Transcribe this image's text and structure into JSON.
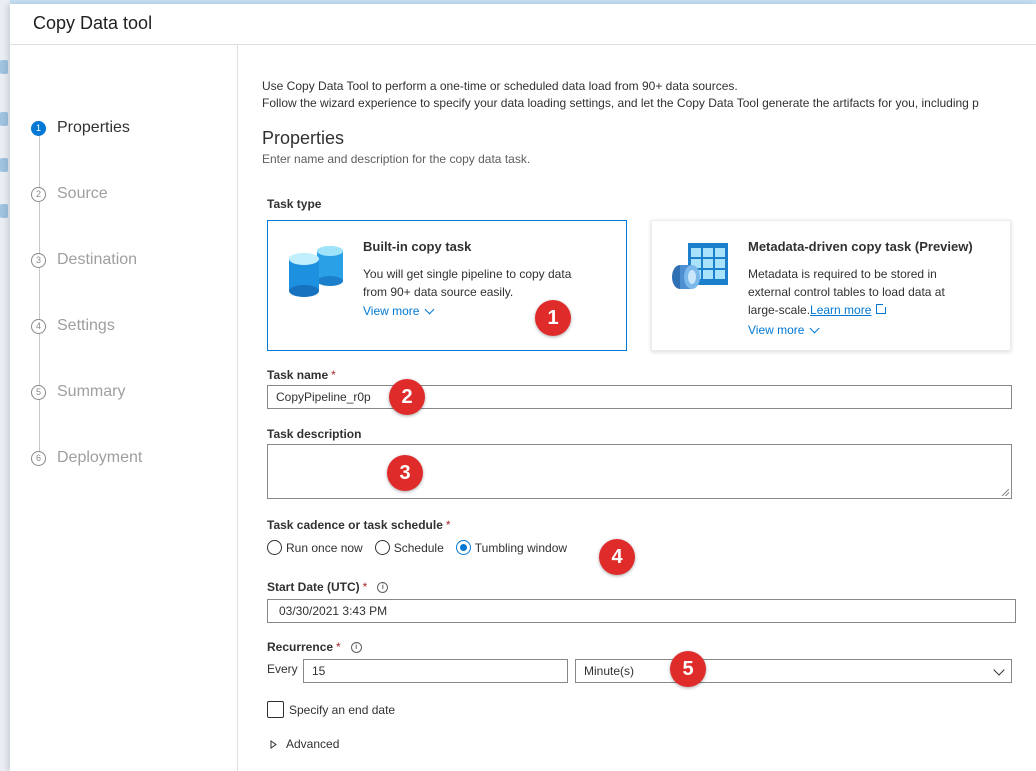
{
  "window": {
    "title": "Copy Data tool"
  },
  "steps": [
    {
      "num": "1",
      "label": "Properties"
    },
    {
      "num": "2",
      "label": "Source"
    },
    {
      "num": "3",
      "label": "Destination"
    },
    {
      "num": "4",
      "label": "Settings"
    },
    {
      "num": "5",
      "label": "Summary"
    },
    {
      "num": "6",
      "label": "Deployment"
    }
  ],
  "intro": {
    "line1": "Use Copy Data Tool to perform a one-time or scheduled data load from 90+ data sources.",
    "line2": "Follow the wizard experience to specify your data loading settings, and let the Copy Data Tool generate the artifacts for you, including p"
  },
  "section": {
    "title": "Properties",
    "subtitle": "Enter name and description for the copy data task."
  },
  "task_type": {
    "label": "Task type",
    "builtin": {
      "title": "Built-in copy task",
      "desc_line1": "You will get single pipeline to copy data",
      "desc_line2": "from 90+ data source easily.",
      "view_more": "View more"
    },
    "metadata": {
      "title": "Metadata-driven copy task (Preview)",
      "desc_line1": "Metadata is required to be stored in",
      "desc_line2": "external control tables to load data at",
      "desc_line3": "large-scale.",
      "learn_more": "Learn more",
      "view_more": "View more"
    }
  },
  "task_name": {
    "label": "Task name",
    "required": "*",
    "value": "CopyPipeline_r0p"
  },
  "task_description": {
    "label": "Task description",
    "value": ""
  },
  "cadence": {
    "label": "Task cadence or task schedule",
    "required": "*",
    "options": [
      "Run once now",
      "Schedule",
      "Tumbling window"
    ],
    "selected": "Tumbling window"
  },
  "start_date": {
    "label": "Start Date (UTC)",
    "required": "*",
    "value": "03/30/2021 3:43 PM"
  },
  "recurrence": {
    "label": "Recurrence",
    "required": "*",
    "every_label": "Every",
    "interval": "15",
    "unit": "Minute(s)"
  },
  "end_date": {
    "label": "Specify an end date",
    "checked": false
  },
  "advanced": {
    "label": "Advanced"
  },
  "callouts": [
    "1",
    "2",
    "3",
    "4",
    "5"
  ],
  "colors": {
    "accent": "#0078d4",
    "callout": "#e02b2b",
    "required": "#a4262c"
  }
}
